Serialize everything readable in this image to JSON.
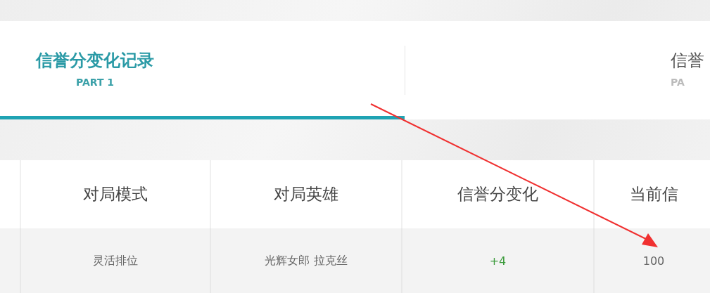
{
  "tabs": [
    {
      "title": "信誉分变化记录",
      "subtitle": "PART 1",
      "selected": true
    },
    {
      "title": "信誉",
      "subtitle": "PA",
      "selected": false
    }
  ],
  "table": {
    "columns": [
      "",
      "对局模式",
      "对局英雄",
      "信誉分变化",
      "当前信"
    ],
    "rows": [
      {
        "cells": [
          "",
          "灵活排位",
          "光辉女郎 拉克丝",
          "+4",
          "100"
        ]
      }
    ]
  }
}
